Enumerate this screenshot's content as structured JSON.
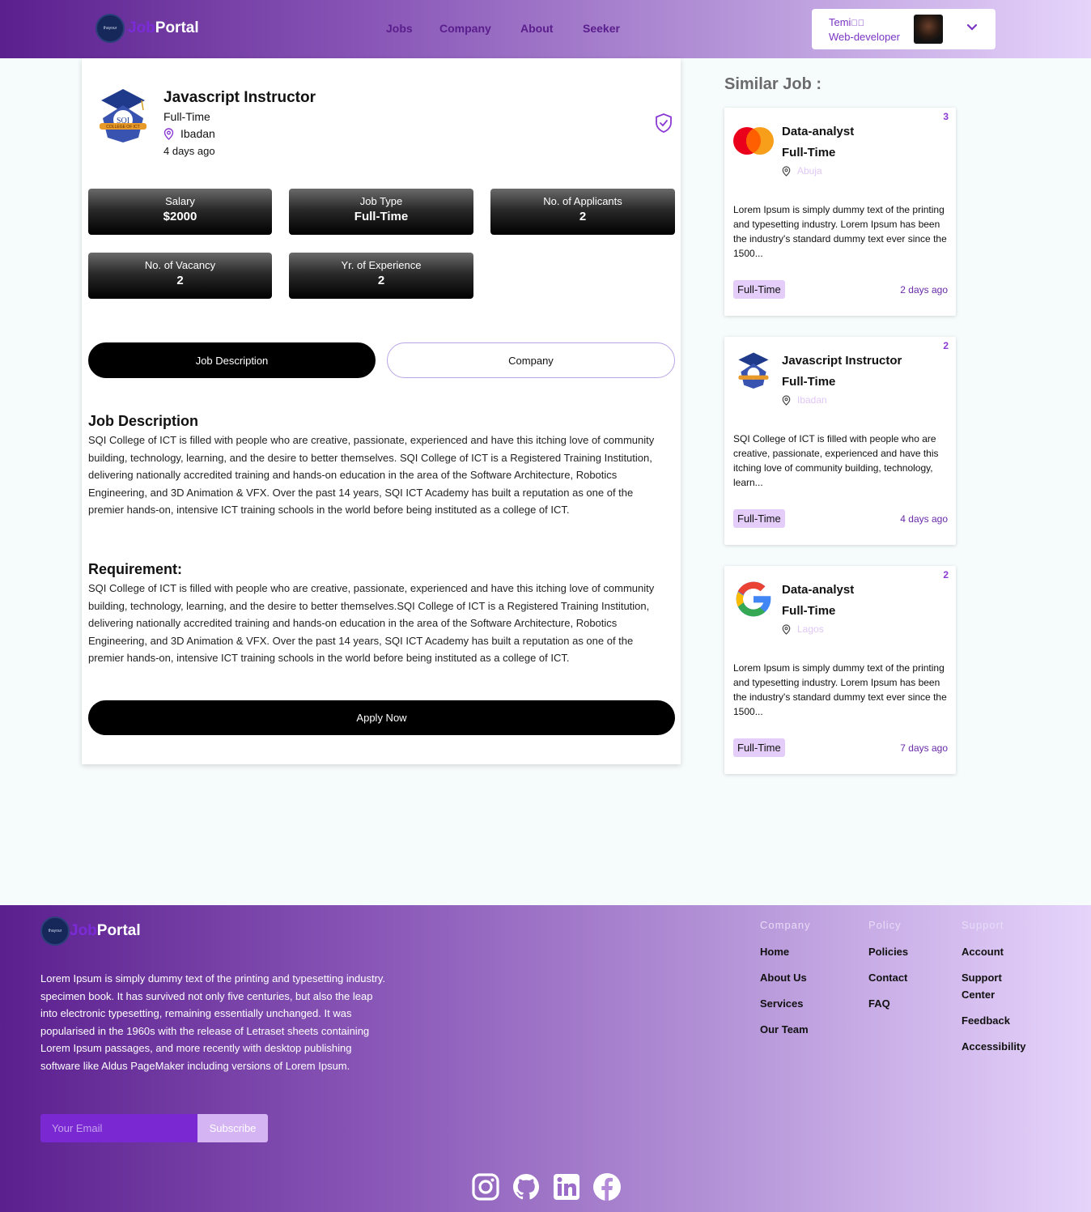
{
  "header": {
    "logo_mark": "thayour",
    "logo_job": "Job",
    "logo_portal": "Portal",
    "nav": [
      "Jobs",
      "Company",
      "About",
      "Seeker"
    ],
    "user_name": "Temi",
    "user_role": "Web-developer"
  },
  "job": {
    "title": "Javascript Instructor",
    "type": "Full-Time",
    "location": "Ibadan",
    "posted": "4 days ago",
    "stats": [
      {
        "label": "Salary",
        "value": "$2000"
      },
      {
        "label": "Job Type",
        "value": "Full-Time"
      },
      {
        "label": "No. of Applicants",
        "value": "2"
      },
      {
        "label": "No. of Vacancy",
        "value": "2"
      },
      {
        "label": "Yr. of Experience",
        "value": "2"
      }
    ],
    "tabs": {
      "active": "Job Description",
      "inactive": "Company"
    },
    "description_title": "Job Description",
    "description": "SQI College of ICT is filled with people who are creative, passionate, experienced and have this itching love of community building, technology, learning, and the desire to better themselves. SQI College of ICT is a Registered Training Institution, delivering nationally accredited training and hands-on education in the area of the Software Architecture, Robotics Engineering, and 3D Animation & VFX. Over the past 14 years, SQI ICT Academy has built a reputation as one of the premier hands-on, intensive ICT training schools in the world before being instituted as a college of ICT.",
    "requirement_title": "Requirement:",
    "requirement": "SQI College of ICT is filled with people who are creative, passionate, experienced and have this itching love of community building, technology, learning, and the desire to better themselves.SQI College of ICT is a Registered Training Institution, delivering nationally accredited training and hands-on education in the area of the Software Architecture, Robotics Engineering, and 3D Animation & VFX. Over the past 14 years, SQI ICT Academy has built a reputation as one of the premier hands-on, intensive ICT training schools in the world before being instituted as a college of ICT.",
    "apply_label": "Apply Now",
    "logo_text": "SQI",
    "logo_ribbon": "COLLEGE OF ICT"
  },
  "similar": {
    "title": "Similar Job :",
    "items": [
      {
        "count": "3",
        "title": "Data-analyst",
        "type": "Full-Time",
        "location": "Abuja",
        "logo": "mastercard-logo",
        "desc": "Lorem Ipsum is simply dummy text of the printing and typesetting industry. Lorem Ipsum has been the industry's standard dummy text ever since the 1500...",
        "badge": "Full-Time",
        "posted": "2 days ago"
      },
      {
        "count": "2",
        "title": "Javascript Instructor",
        "type": "Full-Time",
        "location": "Ibadan",
        "logo": "sqi-logo",
        "desc": "SQI College of ICT is filled with people who are creative, passionate, experienced and have this itching love of community building, technology, learn...",
        "badge": "Full-Time",
        "posted": "4 days ago"
      },
      {
        "count": "2",
        "title": "Data-analyst",
        "type": "Full-Time",
        "location": "Lagos",
        "logo": "google-logo",
        "desc": "Lorem Ipsum is simply dummy text of the printing and typesetting industry. Lorem Ipsum has been the industry's standard dummy text ever since the 1500...",
        "badge": "Full-Time",
        "posted": "7 days ago"
      }
    ]
  },
  "footer": {
    "logo_mark": "thayour",
    "logo_job": "Job",
    "logo_portal": "Portal",
    "description": "Lorem Ipsum is simply dummy text of the printing and typesetting industry. specimen book. It has survived not only five centuries, but also the leap into electronic typesetting, remaining essentially unchanged. It was popularised in the 1960s with the release of Letraset sheets containing Lorem Ipsum passages, and more recently with desktop publishing software like Aldus PageMaker including versions of Lorem Ipsum.",
    "email_placeholder": "Your Email",
    "subscribe_label": "Subscribe",
    "columns": [
      {
        "head": "Company",
        "items": [
          "Home",
          "About Us",
          "Services",
          "Our Team"
        ]
      },
      {
        "head": "Policy",
        "items": [
          "Policies",
          "Contact",
          "FAQ"
        ]
      },
      {
        "head": "Support",
        "items": [
          "Account",
          "Support Center",
          "Feedback",
          "Accessibility"
        ]
      }
    ],
    "socials": [
      "instagram-icon",
      "github-icon",
      "linkedin-icon",
      "facebook-icon"
    ]
  },
  "colors": {
    "accent": "#8a3bd4",
    "nav_text": "#5a1d8c",
    "badge_bg": "#e4cef9"
  }
}
